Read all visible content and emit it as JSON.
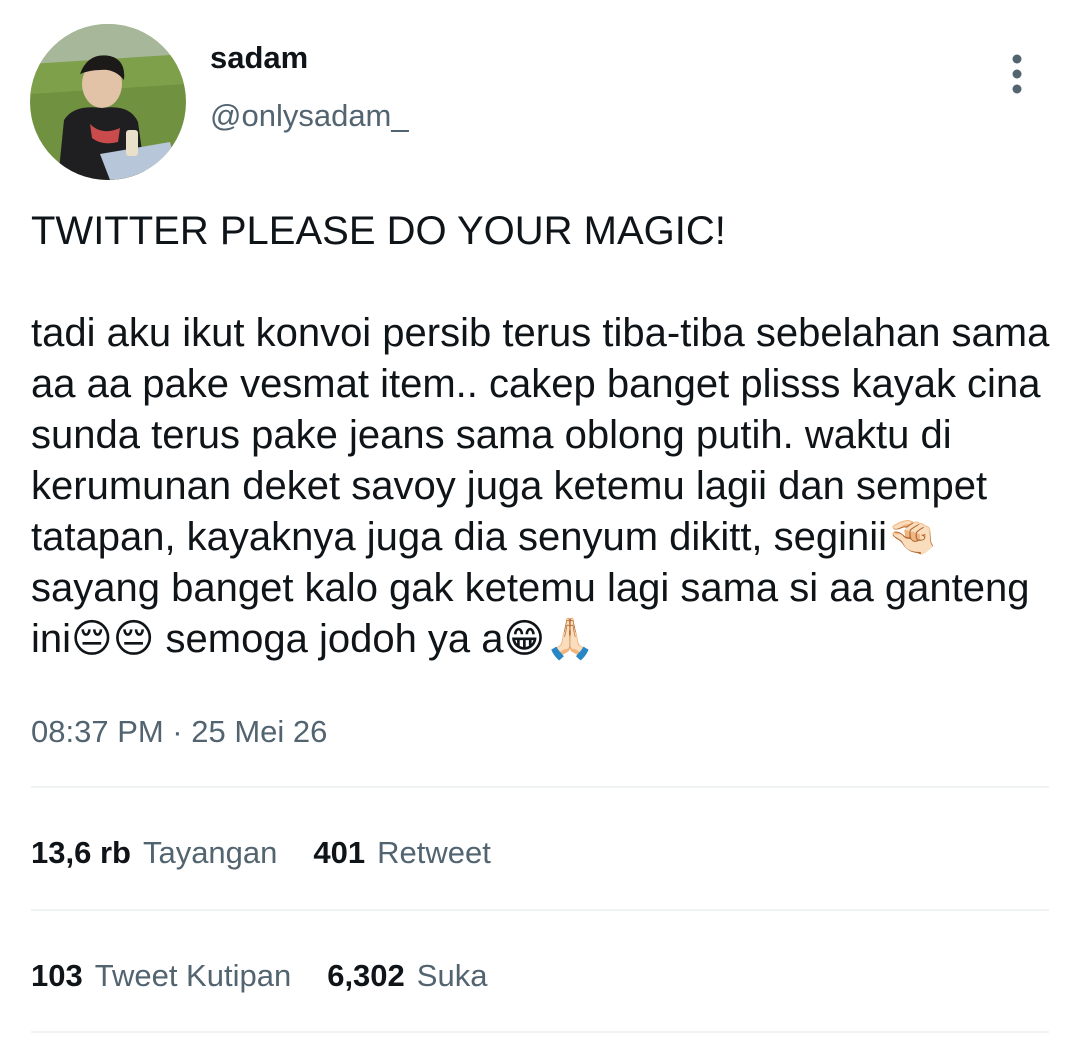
{
  "user": {
    "display_name": "sadam",
    "handle": "@onlysadam_"
  },
  "tweet": {
    "line1": "TWITTER PLEASE DO YOUR MAGIC!",
    "line2": "tadi aku ikut konvoi persib terus tiba-tiba sebelahan sama aa aa pake vesmat item.. cakep banget plisss kayak cina sunda terus pake jeans sama oblong putih. waktu di kerumunan deket savoy juga ketemu lagii dan sempet tatapan, kayaknya juga dia senyum dikitt, seginii🤏🏻 sayang banget kalo gak ketemu lagi sama si aa ganteng ini😔😔 semoga jodoh ya a😁🙏🏻",
    "timestamp": "08:37 PM · 25 Mei 26"
  },
  "stats": {
    "views": {
      "value": "13,6 rb",
      "label": "Tayangan"
    },
    "retweets": {
      "value": "401",
      "label": "Retweet"
    },
    "quotes": {
      "value": "103",
      "label": "Tweet Kutipan"
    },
    "likes": {
      "value": "6,302",
      "label": "Suka"
    }
  },
  "icons": {
    "more": "more-vertical-icon"
  },
  "colors": {
    "text": "#0f1419",
    "secondary": "#536471",
    "divider": "#eff3f4"
  }
}
